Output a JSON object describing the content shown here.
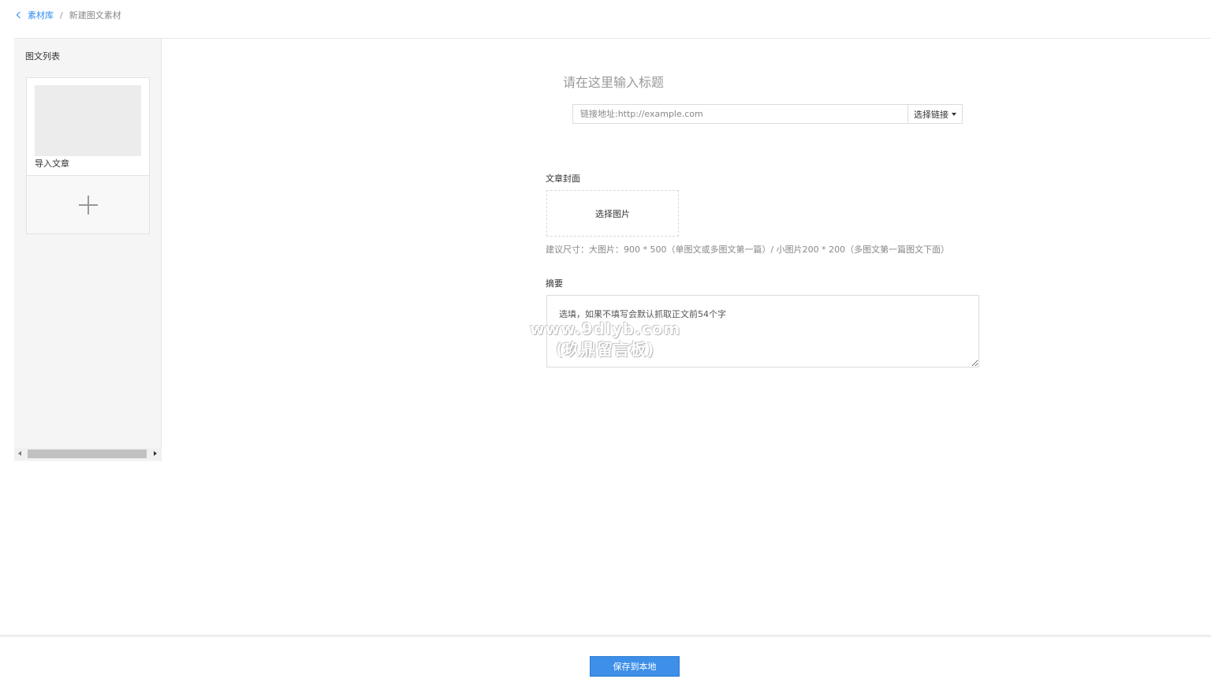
{
  "breadcrumb": {
    "back_label": "素材库",
    "separator": "/",
    "current": "新建图文素材"
  },
  "sidebar": {
    "title": "图文列表",
    "articles": [
      {
        "label": "导入文章"
      }
    ]
  },
  "editor": {
    "title_placeholder": "请在这里输入标题",
    "link_placeholder": "链接地址:http://example.com",
    "link_button": "选择链接",
    "cover_label": "文章封面",
    "cover_button": "选择图片",
    "cover_hint": "建议尺寸：大图片：900 * 500（单图文或多图文第一篇）/ 小图片200 * 200（多图文第一篇图文下面）",
    "summary_label": "摘要",
    "summary_placeholder": "选填，如果不填写会默认抓取正文前54个字"
  },
  "watermark": {
    "line1": "www.9dlyb.com",
    "line2": "(玖鼎留言板)"
  },
  "footer": {
    "save_label": "保存到本地"
  },
  "colors": {
    "accent": "#3d8fe8",
    "link": "#2d8cf0",
    "sidebar_bg": "#f5f5f5"
  }
}
